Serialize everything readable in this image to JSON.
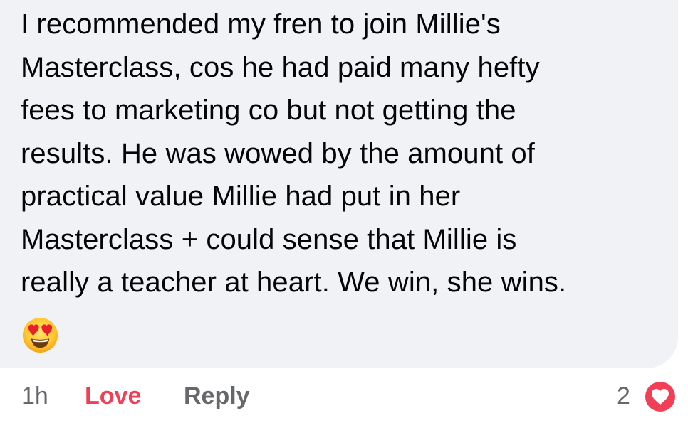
{
  "comment": {
    "lines": [
      "I recommended my fren to join Millie's",
      "Masterclass, cos he had paid many hefty",
      "fees to marketing co but not getting the",
      "results. He was wowed by the amount of",
      "practical value Millie had put in her",
      "Masterclass + could sense that Millie is",
      "really a teacher at heart.  We win, she wins."
    ],
    "emoji": "smiling-face-with-heart-eyes-icon"
  },
  "actions": {
    "timestamp": "1h",
    "love_label": "Love",
    "reply_label": "Reply",
    "reaction_count": "2",
    "reaction_icon": "heart-icon"
  },
  "colors": {
    "bubble_bg": "#f0f2f5",
    "text": "#050505",
    "muted": "#65676b",
    "love": "#f33e58"
  }
}
